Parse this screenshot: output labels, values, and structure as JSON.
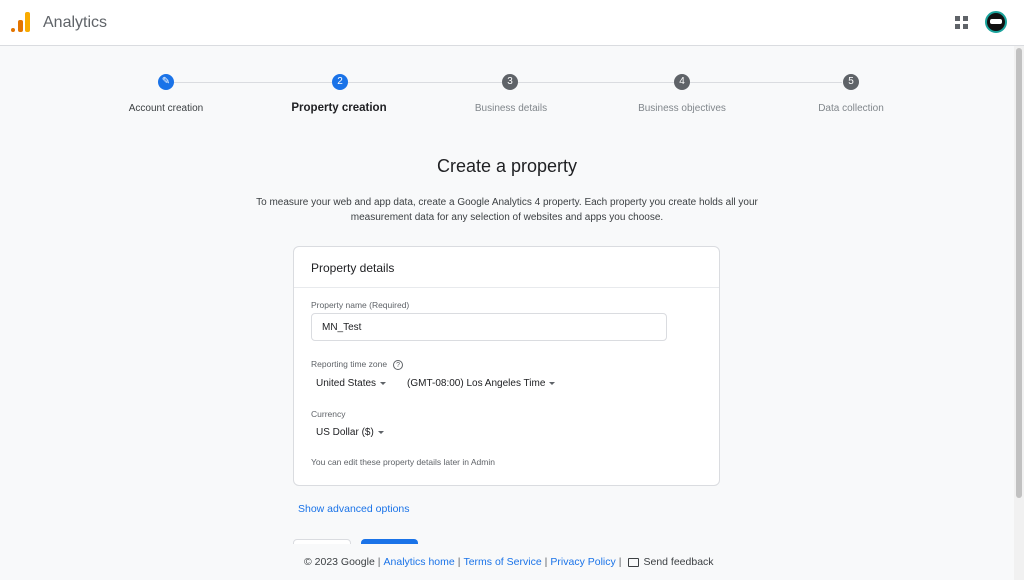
{
  "header": {
    "app_title": "Analytics",
    "logo_icon": "analytics-logo-icon",
    "apps_icon": "grid-apps-icon",
    "avatar_icon": "user-avatar"
  },
  "stepper": {
    "steps": [
      {
        "label": "Account creation",
        "marker": "✎",
        "state": "done"
      },
      {
        "label": "Property creation",
        "marker": "2",
        "state": "active"
      },
      {
        "label": "Business details",
        "marker": "3",
        "state": "todo"
      },
      {
        "label": "Business objectives",
        "marker": "4",
        "state": "todo"
      },
      {
        "label": "Data collection",
        "marker": "5",
        "state": "todo"
      }
    ]
  },
  "main": {
    "heading": "Create a property",
    "description": "To measure your web and app data, create a Google Analytics 4 property. Each property you create holds all your measurement data for any selection of websites and apps you choose."
  },
  "card": {
    "title": "Property details",
    "property_name_label": "Property name (Required)",
    "property_name_value": "MN_Test",
    "timezone_label": "Reporting time zone",
    "country_value": "United States",
    "timezone_value": "(GMT-08:00) Los Angeles Time",
    "currency_label": "Currency",
    "currency_value": "US Dollar ($)",
    "hint": "You can edit these property details later in Admin"
  },
  "actions": {
    "advanced_link": "Show advanced options"
  },
  "footer": {
    "copyright": "© 2023 Google",
    "links": [
      "Analytics home",
      "Terms of Service",
      "Privacy Policy"
    ],
    "feedback": "Send feedback"
  },
  "colors": {
    "accent": "#1a73e8",
    "pending_step": "#5f6368",
    "background": "#f8f9fa"
  }
}
